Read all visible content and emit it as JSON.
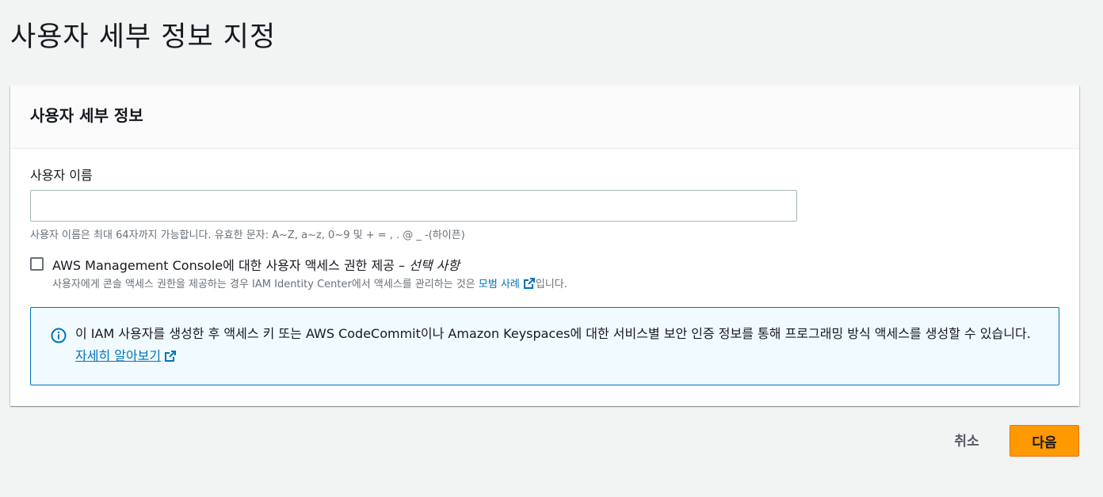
{
  "page": {
    "title": "사용자 세부 정보 지정"
  },
  "panel": {
    "title": "사용자 세부 정보",
    "username_label": "사용자 이름",
    "username_value": "",
    "username_hint": "사용자 이름은 최대 64자까지 가능합니다. 유효한 문자: A~Z, a~z, 0~9 및 + = , . @ _ -(하이픈)",
    "console_access": {
      "checked": false,
      "label": "AWS Management Console에 대한 사용자 액세스 권한 제공 –",
      "optional": "선택 사항",
      "desc_before": "사용자에게 콘솔 액세스 권한을 제공하는 경우 IAM Identity Center에서 액세스를 관리하는 것은",
      "desc_link": "모범 사례",
      "desc_after": "입니다."
    },
    "info": {
      "text": "이 IAM 사용자를 생성한 후 액세스 키 또는 AWS CodeCommit이나 Amazon Keyspaces에 대한 서비스별 보안 인증 정보를 통해 프로그래밍 방식 액세스를 생성할 수 있습니다.",
      "link": "자세히 알아보기"
    }
  },
  "footer": {
    "cancel_label": "취소",
    "next_label": "다음"
  },
  "colors": {
    "accent": "#ff9900",
    "link": "#0073bb",
    "info_bg": "#f1faff"
  }
}
